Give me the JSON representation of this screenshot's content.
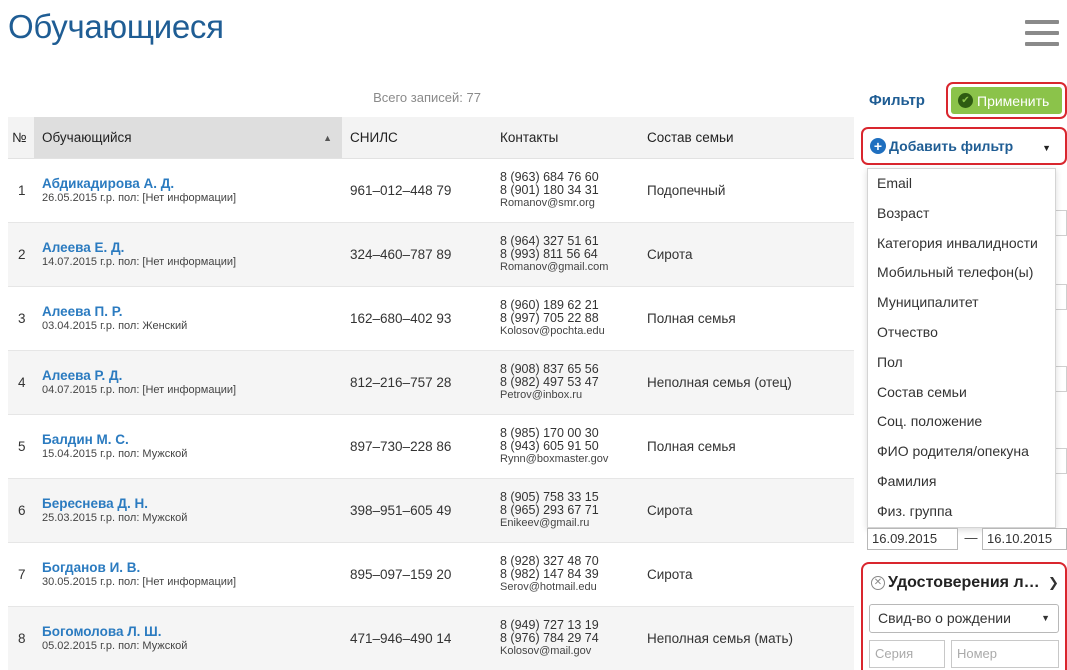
{
  "page": {
    "title": "Обучающиеся"
  },
  "list": {
    "total": "Всего записей: 77",
    "columns": {
      "num": "№",
      "student": "Обучающийся",
      "snils": "СНИЛС",
      "contacts": "Контакты",
      "family": "Состав семьи"
    },
    "rows": [
      {
        "num": "1",
        "name": "Абдикадирова А. Д.",
        "info": "26.05.2015 г.р. пол: [Нет информации]",
        "snils": "961–012–448 79",
        "phone1": "8 (963) 684 76 60",
        "phone2": "8 (901) 180 34 31",
        "email": "Romanov@smr.org",
        "family": "Подопечный"
      },
      {
        "num": "2",
        "name": "Алеева Е. Д.",
        "info": "14.07.2015 г.р. пол: [Нет информации]",
        "snils": "324–460–787 89",
        "phone1": "8 (964) 327 51 61",
        "phone2": "8 (993) 811 56 64",
        "email": "Romanov@gmail.com",
        "family": "Сирота"
      },
      {
        "num": "3",
        "name": "Алеева П. Р.",
        "info": "03.04.2015 г.р. пол: Женский",
        "snils": "162–680–402 93",
        "phone1": "8 (960) 189 62 21",
        "phone2": "8 (997) 705 22 88",
        "email": "Kolosov@pochta.edu",
        "family": "Полная семья"
      },
      {
        "num": "4",
        "name": "Алеева Р. Д.",
        "info": "04.07.2015 г.р. пол: [Нет информации]",
        "snils": "812–216–757 28",
        "phone1": "8 (908) 837 65 56",
        "phone2": "8 (982) 497 53 47",
        "email": "Petrov@inbox.ru",
        "family": "Неполная семья (отец)"
      },
      {
        "num": "5",
        "name": "Балдин М. С.",
        "info": "15.04.2015 г.р. пол: Мужской",
        "snils": "897–730–228 86",
        "phone1": "8 (985) 170 00 30",
        "phone2": "8 (943) 605 91 50",
        "email": "Rynn@boxmaster.gov",
        "family": "Полная семья"
      },
      {
        "num": "6",
        "name": "Береснева Д. Н.",
        "info": "25.03.2015 г.р. пол: Мужской",
        "snils": "398–951–605 49",
        "phone1": "8 (905) 758 33 15",
        "phone2": "8 (965) 293 67 71",
        "email": "Enikeev@gmail.ru",
        "family": "Сирота"
      },
      {
        "num": "7",
        "name": "Богданов И. В.",
        "info": "30.05.2015 г.р. пол: [Нет информации]",
        "snils": "895–097–159 20",
        "phone1": "8 (928) 327 48 70",
        "phone2": "8 (982) 147 84 39",
        "email": "Serov@hotmail.edu",
        "family": "Сирота"
      },
      {
        "num": "8",
        "name": "Богомолова Л. Ш.",
        "info": "05.02.2015 г.р. пол: Мужской",
        "snils": "471–946–490 14",
        "phone1": "8 (949) 727 13 19",
        "phone2": "8 (976) 784 29 74",
        "email": "Kolosov@mail.gov",
        "family": "Неполная семья (мать)"
      }
    ]
  },
  "filter": {
    "label": "Фильтр",
    "apply": "Применить",
    "add_filter": "Добавить фильтр",
    "options": [
      "Email",
      "Возраст",
      "Категория инвалидности",
      "Мобильный телефон(ы)",
      "Муниципалитет",
      "Отчество",
      "Пол",
      "Состав семьи",
      "Соц. положение",
      "ФИО родителя/опекуна",
      "Фамилия",
      "Физ. группа"
    ],
    "date_from": "16.09.2015",
    "date_sep": "—",
    "date_to": "16.10.2015",
    "certificate": {
      "title": "Удостоверения ли...",
      "doc_type": "Свид-во о рождении",
      "series_placeholder": "Серия",
      "number_placeholder": "Номер"
    }
  },
  "colors": {
    "title_blue": "#1f5d94",
    "link_blue": "#2b7bc0",
    "apply_green": "#8bc34a",
    "highlight_red": "#d9262e"
  }
}
